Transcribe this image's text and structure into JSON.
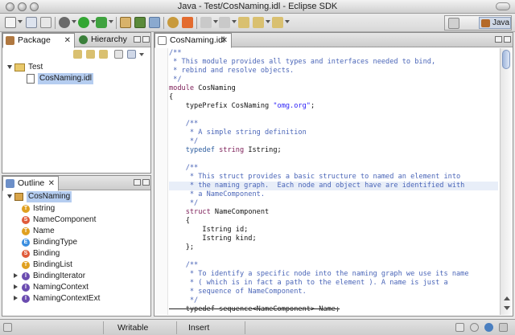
{
  "window": {
    "title": "Java - Test/CosNaming.idl - Eclipse SDK"
  },
  "perspective": {
    "label": "Java"
  },
  "left_top_panel": {
    "tabs": [
      {
        "label": "Package",
        "close": "✕"
      },
      {
        "label": "Hierarchy"
      }
    ],
    "tree": [
      {
        "label": "Test",
        "icon": "folder-icon"
      },
      {
        "label": "CosNaming.idl",
        "icon": "file-icon",
        "selected": true
      }
    ]
  },
  "outline_panel": {
    "tab_label": "Outline",
    "tab_close": "✕",
    "root": "CosNaming",
    "items": [
      {
        "label": "Istring",
        "badge": "T",
        "color": "#e0a020",
        "expander": false
      },
      {
        "label": "NameComponent",
        "badge": "S",
        "color": "#e05b3a",
        "expander": false
      },
      {
        "label": "Name",
        "badge": "T",
        "color": "#e0a020",
        "expander": false
      },
      {
        "label": "BindingType",
        "badge": "E",
        "color": "#3a8ee0",
        "expander": false
      },
      {
        "label": "Binding",
        "badge": "S",
        "color": "#e05b3a",
        "expander": false
      },
      {
        "label": "BindingList",
        "badge": "T",
        "color": "#e0a020",
        "expander": false
      },
      {
        "label": "BindingIterator",
        "badge": "I",
        "color": "#6b4cb0",
        "expander": true
      },
      {
        "label": "NamingContext",
        "badge": "I",
        "color": "#6b4cb0",
        "expander": true
      },
      {
        "label": "NamingContextExt",
        "badge": "I",
        "color": "#6b4cb0",
        "expander": true
      }
    ]
  },
  "editor": {
    "tab_label": "CosNaming.idl",
    "tab_close": "✕",
    "lines": [
      [
        {
          "t": "/**",
          "c": "com"
        }
      ],
      [
        {
          "t": " * This module provides all types and interfaces needed to bind,",
          "c": "com"
        }
      ],
      [
        {
          "t": " * rebind and resolve objects.",
          "c": "com"
        }
      ],
      [
        {
          "t": " */",
          "c": "com"
        }
      ],
      [
        {
          "t": "module ",
          "c": "kw"
        },
        {
          "t": "CosNaming",
          "c": "plain"
        }
      ],
      [
        {
          "t": "{",
          "c": "plain"
        }
      ],
      [
        {
          "t": "    typePrefix CosNaming ",
          "c": "plain"
        },
        {
          "t": "\"omg.org\"",
          "c": "str"
        },
        {
          "t": ";",
          "c": "plain"
        }
      ],
      [
        {
          "t": "",
          "c": "plain"
        }
      ],
      [
        {
          "t": "    /**",
          "c": "com"
        }
      ],
      [
        {
          "t": "     * A simple string definition",
          "c": "com"
        }
      ],
      [
        {
          "t": "     */",
          "c": "com"
        }
      ],
      [
        {
          "t": "    typedef ",
          "c": "ty"
        },
        {
          "t": "string ",
          "c": "kw"
        },
        {
          "t": "Istring;",
          "c": "plain"
        }
      ],
      [
        {
          "t": "",
          "c": "plain"
        }
      ],
      [
        {
          "t": "    /**",
          "c": "com"
        }
      ],
      [
        {
          "t": "     * This struct provides a basic structure to named an element into",
          "c": "com"
        }
      ],
      [
        {
          "t": "     * the naming graph.  Each node and object have are identified with",
          "c": "com"
        }
      ],
      [
        {
          "t": "     * a NameComponent.",
          "c": "com"
        }
      ],
      [
        {
          "t": "     */",
          "c": "com"
        }
      ],
      [
        {
          "t": "    struct ",
          "c": "kw"
        },
        {
          "t": "NameComponent",
          "c": "plain"
        }
      ],
      [
        {
          "t": "    {",
          "c": "plain"
        }
      ],
      [
        {
          "t": "        Istring id;",
          "c": "plain"
        }
      ],
      [
        {
          "t": "        Istring kind;",
          "c": "plain"
        }
      ],
      [
        {
          "t": "    };",
          "c": "plain"
        }
      ],
      [
        {
          "t": "",
          "c": "plain"
        }
      ],
      [
        {
          "t": "    /**",
          "c": "com"
        }
      ],
      [
        {
          "t": "     * To identify a specific node into the naming graph we use its name",
          "c": "com"
        }
      ],
      [
        {
          "t": "     * ( which is in fact a path to the element ). A name is just a",
          "c": "com"
        }
      ],
      [
        {
          "t": "     * sequence of NameComponent.",
          "c": "com"
        }
      ],
      [
        {
          "t": "     */",
          "c": "com"
        }
      ],
      [
        {
          "t": "    typedef sequence<NameComponent> Name;",
          "c": "strike"
        }
      ]
    ],
    "highlighted_line": 15
  },
  "status": {
    "writable": "Writable",
    "mode": "Insert"
  }
}
